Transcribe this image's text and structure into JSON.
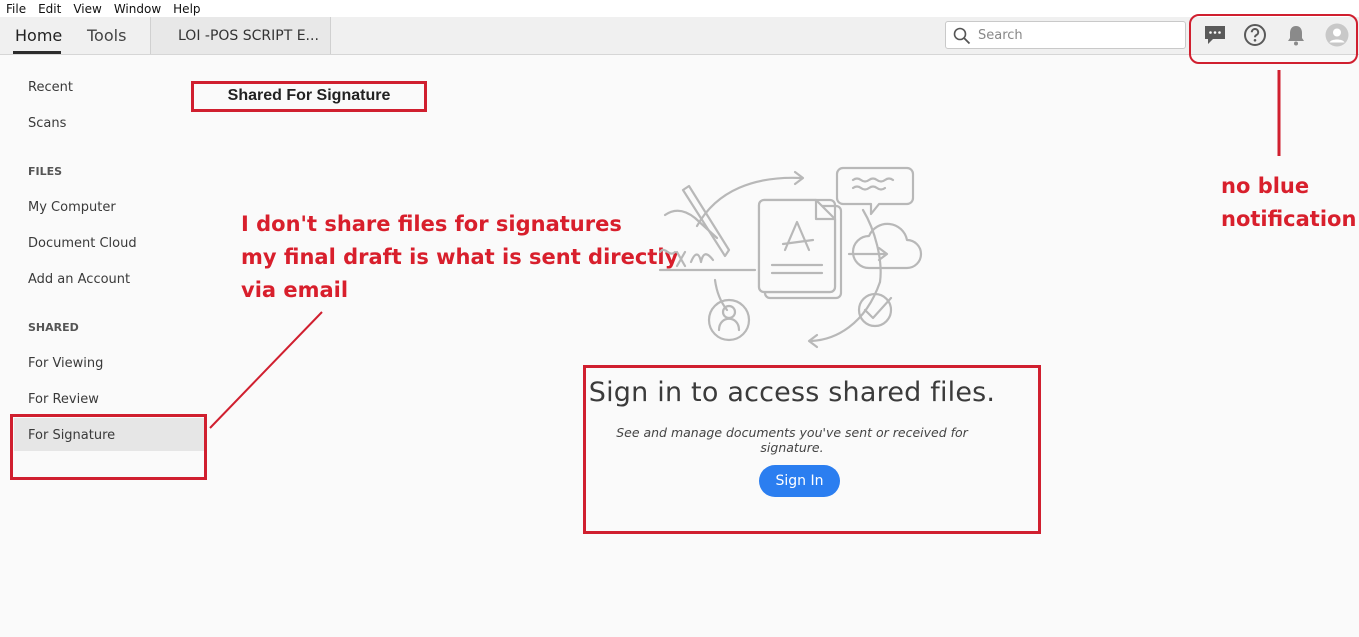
{
  "menu": [
    "File",
    "Edit",
    "View",
    "Window",
    "Help"
  ],
  "tabs": {
    "home": "Home",
    "tools": "Tools",
    "document": "LOI -POS SCRIPT E..."
  },
  "search": {
    "placeholder": "Search"
  },
  "top_icons": [
    "comment-icon",
    "help-icon",
    "bell-icon",
    "user-avatar-icon"
  ],
  "sidebar": {
    "recent": "Recent",
    "scans": "Scans",
    "files_heading": "FILES",
    "my_computer": "My Computer",
    "document_cloud": "Document Cloud",
    "add_account": "Add an Account",
    "shared_heading": "SHARED",
    "for_viewing": "For Viewing",
    "for_review": "For Review",
    "for_signature": "For Signature"
  },
  "main": {
    "heading": "Shared For Signature",
    "signin_title": "Sign in to access shared files.",
    "signin_sub": "See and manage documents you've sent or received for signature.",
    "signin_button": "Sign In"
  },
  "annotations": {
    "left_line1": "I don't share files for signatures",
    "left_line2": "my final draft is what is sent directly",
    "left_line3": "via email",
    "right_line1": "no blue",
    "right_line2": "notification"
  },
  "colors": {
    "annotation_red": "#d01f2f",
    "signin_blue": "#2b7ef0"
  }
}
